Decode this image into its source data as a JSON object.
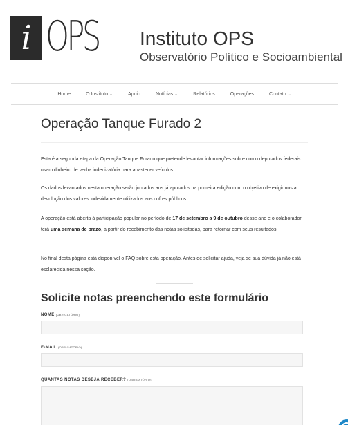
{
  "header": {
    "logo_letter": "i",
    "logo_ops": "OPS",
    "title": "Instituto OPS",
    "subtitle": "Observatório Político e Socioambiental"
  },
  "nav": {
    "items": [
      {
        "label": "Home",
        "has_dropdown": false
      },
      {
        "label": "O Instituto",
        "has_dropdown": true
      },
      {
        "label": "Apoio",
        "has_dropdown": false
      },
      {
        "label": "Notícias",
        "has_dropdown": true
      },
      {
        "label": "Relatórios",
        "has_dropdown": false
      },
      {
        "label": "Operações",
        "has_dropdown": false
      },
      {
        "label": "Contato",
        "has_dropdown": true
      }
    ],
    "chevron": "⌄"
  },
  "page": {
    "title": "Operação Tanque Furado 2",
    "p1": "Esta é a segunda etapa da Operação Tanque Furado que pretende levantar informações sobre como deputados federais usam dinheiro de verba indenizatória para abastecer veículos.",
    "p2": "Os dados levantados nesta operação serão juntados aos já apurados na primeira edição com o objetivo de exigirmos a devolução dos valores indevidamente utilizados aos cofres públicos.",
    "p3_a": "A operação está aberta à participação popular no período de ",
    "p3_b": "17 de setembro a 9 de outubro",
    "p3_c": " desse ano e o colaborador terá ",
    "p3_d": "uma semana de prazo",
    "p3_e": ", a partir do recebimento das notas solicitadas, para retornar com seus resultados.",
    "p4": "No final desta página está disponível o FAQ sobre esta operação. Antes de solicitar ajuda, veja se sua dúvida já não está esclarecida nessa seção."
  },
  "form": {
    "title": "Solicite notas preenchendo este formulário",
    "required": "(OBRIGATÓRIO)",
    "name_label": "NOME",
    "email_label": "E-MAIL",
    "qty_label": "QUANTAS NOTAS DESEJA RECEBER?"
  }
}
